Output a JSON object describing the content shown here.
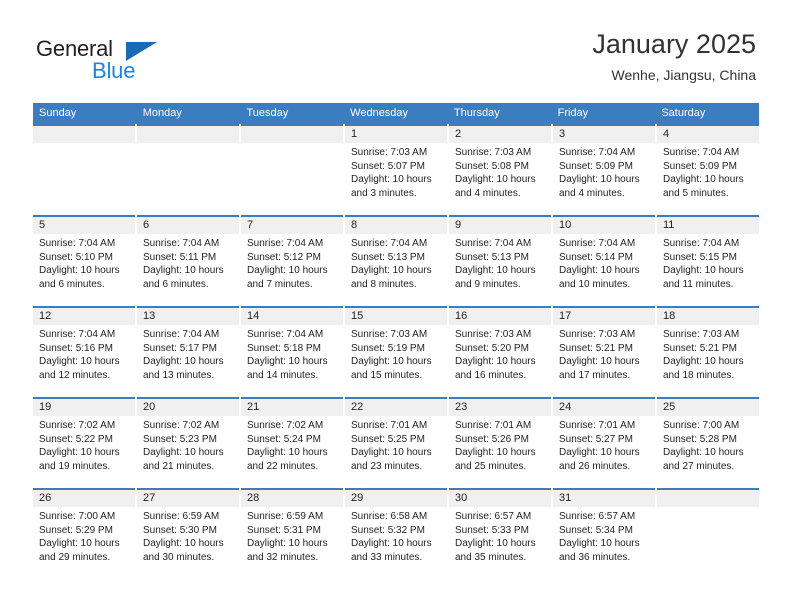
{
  "brand": {
    "name_part1": "General",
    "name_part2": "Blue",
    "triangle_color": "#1b6ab3",
    "blue_color": "#1b87dd"
  },
  "header": {
    "month_title": "January 2025",
    "location": "Wenhe, Jiangsu, China"
  },
  "theme": {
    "header_blue": "#3a7dc0",
    "day_strip_gray": "#f0f0f0",
    "text_color": "#231f20"
  },
  "weekdays": [
    "Sunday",
    "Monday",
    "Tuesday",
    "Wednesday",
    "Thursday",
    "Friday",
    "Saturday"
  ],
  "weeks": [
    [
      {
        "day": "",
        "sunrise": "",
        "sunset": "",
        "daylight_line1": "",
        "daylight_line2": ""
      },
      {
        "day": "",
        "sunrise": "",
        "sunset": "",
        "daylight_line1": "",
        "daylight_line2": ""
      },
      {
        "day": "",
        "sunrise": "",
        "sunset": "",
        "daylight_line1": "",
        "daylight_line2": ""
      },
      {
        "day": "1",
        "sunrise": "Sunrise: 7:03 AM",
        "sunset": "Sunset: 5:07 PM",
        "daylight_line1": "Daylight: 10 hours",
        "daylight_line2": "and 3 minutes."
      },
      {
        "day": "2",
        "sunrise": "Sunrise: 7:03 AM",
        "sunset": "Sunset: 5:08 PM",
        "daylight_line1": "Daylight: 10 hours",
        "daylight_line2": "and 4 minutes."
      },
      {
        "day": "3",
        "sunrise": "Sunrise: 7:04 AM",
        "sunset": "Sunset: 5:09 PM",
        "daylight_line1": "Daylight: 10 hours",
        "daylight_line2": "and 4 minutes."
      },
      {
        "day": "4",
        "sunrise": "Sunrise: 7:04 AM",
        "sunset": "Sunset: 5:09 PM",
        "daylight_line1": "Daylight: 10 hours",
        "daylight_line2": "and 5 minutes."
      }
    ],
    [
      {
        "day": "5",
        "sunrise": "Sunrise: 7:04 AM",
        "sunset": "Sunset: 5:10 PM",
        "daylight_line1": "Daylight: 10 hours",
        "daylight_line2": "and 6 minutes."
      },
      {
        "day": "6",
        "sunrise": "Sunrise: 7:04 AM",
        "sunset": "Sunset: 5:11 PM",
        "daylight_line1": "Daylight: 10 hours",
        "daylight_line2": "and 6 minutes."
      },
      {
        "day": "7",
        "sunrise": "Sunrise: 7:04 AM",
        "sunset": "Sunset: 5:12 PM",
        "daylight_line1": "Daylight: 10 hours",
        "daylight_line2": "and 7 minutes."
      },
      {
        "day": "8",
        "sunrise": "Sunrise: 7:04 AM",
        "sunset": "Sunset: 5:13 PM",
        "daylight_line1": "Daylight: 10 hours",
        "daylight_line2": "and 8 minutes."
      },
      {
        "day": "9",
        "sunrise": "Sunrise: 7:04 AM",
        "sunset": "Sunset: 5:13 PM",
        "daylight_line1": "Daylight: 10 hours",
        "daylight_line2": "and 9 minutes."
      },
      {
        "day": "10",
        "sunrise": "Sunrise: 7:04 AM",
        "sunset": "Sunset: 5:14 PM",
        "daylight_line1": "Daylight: 10 hours",
        "daylight_line2": "and 10 minutes."
      },
      {
        "day": "11",
        "sunrise": "Sunrise: 7:04 AM",
        "sunset": "Sunset: 5:15 PM",
        "daylight_line1": "Daylight: 10 hours",
        "daylight_line2": "and 11 minutes."
      }
    ],
    [
      {
        "day": "12",
        "sunrise": "Sunrise: 7:04 AM",
        "sunset": "Sunset: 5:16 PM",
        "daylight_line1": "Daylight: 10 hours",
        "daylight_line2": "and 12 minutes."
      },
      {
        "day": "13",
        "sunrise": "Sunrise: 7:04 AM",
        "sunset": "Sunset: 5:17 PM",
        "daylight_line1": "Daylight: 10 hours",
        "daylight_line2": "and 13 minutes."
      },
      {
        "day": "14",
        "sunrise": "Sunrise: 7:04 AM",
        "sunset": "Sunset: 5:18 PM",
        "daylight_line1": "Daylight: 10 hours",
        "daylight_line2": "and 14 minutes."
      },
      {
        "day": "15",
        "sunrise": "Sunrise: 7:03 AM",
        "sunset": "Sunset: 5:19 PM",
        "daylight_line1": "Daylight: 10 hours",
        "daylight_line2": "and 15 minutes."
      },
      {
        "day": "16",
        "sunrise": "Sunrise: 7:03 AM",
        "sunset": "Sunset: 5:20 PM",
        "daylight_line1": "Daylight: 10 hours",
        "daylight_line2": "and 16 minutes."
      },
      {
        "day": "17",
        "sunrise": "Sunrise: 7:03 AM",
        "sunset": "Sunset: 5:21 PM",
        "daylight_line1": "Daylight: 10 hours",
        "daylight_line2": "and 17 minutes."
      },
      {
        "day": "18",
        "sunrise": "Sunrise: 7:03 AM",
        "sunset": "Sunset: 5:21 PM",
        "daylight_line1": "Daylight: 10 hours",
        "daylight_line2": "and 18 minutes."
      }
    ],
    [
      {
        "day": "19",
        "sunrise": "Sunrise: 7:02 AM",
        "sunset": "Sunset: 5:22 PM",
        "daylight_line1": "Daylight: 10 hours",
        "daylight_line2": "and 19 minutes."
      },
      {
        "day": "20",
        "sunrise": "Sunrise: 7:02 AM",
        "sunset": "Sunset: 5:23 PM",
        "daylight_line1": "Daylight: 10 hours",
        "daylight_line2": "and 21 minutes."
      },
      {
        "day": "21",
        "sunrise": "Sunrise: 7:02 AM",
        "sunset": "Sunset: 5:24 PM",
        "daylight_line1": "Daylight: 10 hours",
        "daylight_line2": "and 22 minutes."
      },
      {
        "day": "22",
        "sunrise": "Sunrise: 7:01 AM",
        "sunset": "Sunset: 5:25 PM",
        "daylight_line1": "Daylight: 10 hours",
        "daylight_line2": "and 23 minutes."
      },
      {
        "day": "23",
        "sunrise": "Sunrise: 7:01 AM",
        "sunset": "Sunset: 5:26 PM",
        "daylight_line1": "Daylight: 10 hours",
        "daylight_line2": "and 25 minutes."
      },
      {
        "day": "24",
        "sunrise": "Sunrise: 7:01 AM",
        "sunset": "Sunset: 5:27 PM",
        "daylight_line1": "Daylight: 10 hours",
        "daylight_line2": "and 26 minutes."
      },
      {
        "day": "25",
        "sunrise": "Sunrise: 7:00 AM",
        "sunset": "Sunset: 5:28 PM",
        "daylight_line1": "Daylight: 10 hours",
        "daylight_line2": "and 27 minutes."
      }
    ],
    [
      {
        "day": "26",
        "sunrise": "Sunrise: 7:00 AM",
        "sunset": "Sunset: 5:29 PM",
        "daylight_line1": "Daylight: 10 hours",
        "daylight_line2": "and 29 minutes."
      },
      {
        "day": "27",
        "sunrise": "Sunrise: 6:59 AM",
        "sunset": "Sunset: 5:30 PM",
        "daylight_line1": "Daylight: 10 hours",
        "daylight_line2": "and 30 minutes."
      },
      {
        "day": "28",
        "sunrise": "Sunrise: 6:59 AM",
        "sunset": "Sunset: 5:31 PM",
        "daylight_line1": "Daylight: 10 hours",
        "daylight_line2": "and 32 minutes."
      },
      {
        "day": "29",
        "sunrise": "Sunrise: 6:58 AM",
        "sunset": "Sunset: 5:32 PM",
        "daylight_line1": "Daylight: 10 hours",
        "daylight_line2": "and 33 minutes."
      },
      {
        "day": "30",
        "sunrise": "Sunrise: 6:57 AM",
        "sunset": "Sunset: 5:33 PM",
        "daylight_line1": "Daylight: 10 hours",
        "daylight_line2": "and 35 minutes."
      },
      {
        "day": "31",
        "sunrise": "Sunrise: 6:57 AM",
        "sunset": "Sunset: 5:34 PM",
        "daylight_line1": "Daylight: 10 hours",
        "daylight_line2": "and 36 minutes."
      },
      {
        "day": "",
        "sunrise": "",
        "sunset": "",
        "daylight_line1": "",
        "daylight_line2": ""
      }
    ]
  ]
}
